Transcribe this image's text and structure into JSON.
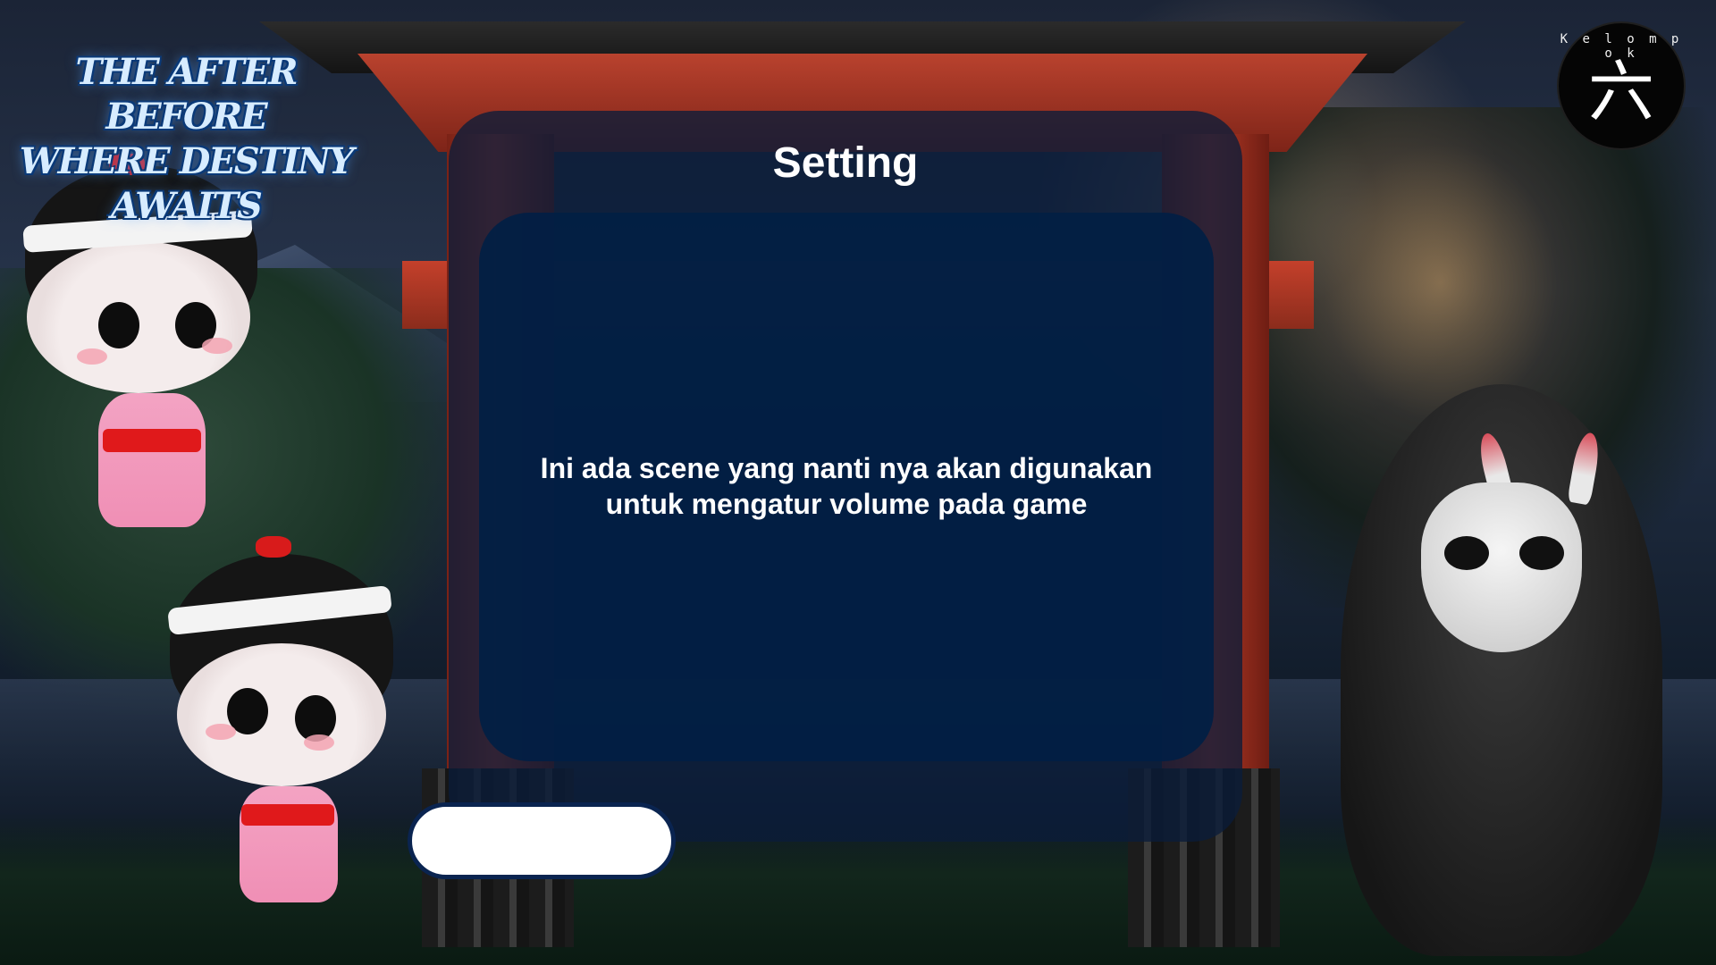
{
  "game": {
    "logo_line1": "THE AFTER BEFORE",
    "logo_line2": "WHERE DESTINY AWAITS"
  },
  "studio": {
    "ring_text": "K e l o m p o k",
    "glyph": "六"
  },
  "setting": {
    "title": "Setting",
    "description_line1": "Ini ada scene yang nanti nya akan digunakan",
    "description_line2": "untuk mengatur volume pada game",
    "back_button_label": ""
  },
  "colors": {
    "panel_outer": "#0a1c3a",
    "panel_inner": "#021f44",
    "torii_red": "#b9422e",
    "button_fill": "#ffffff"
  }
}
